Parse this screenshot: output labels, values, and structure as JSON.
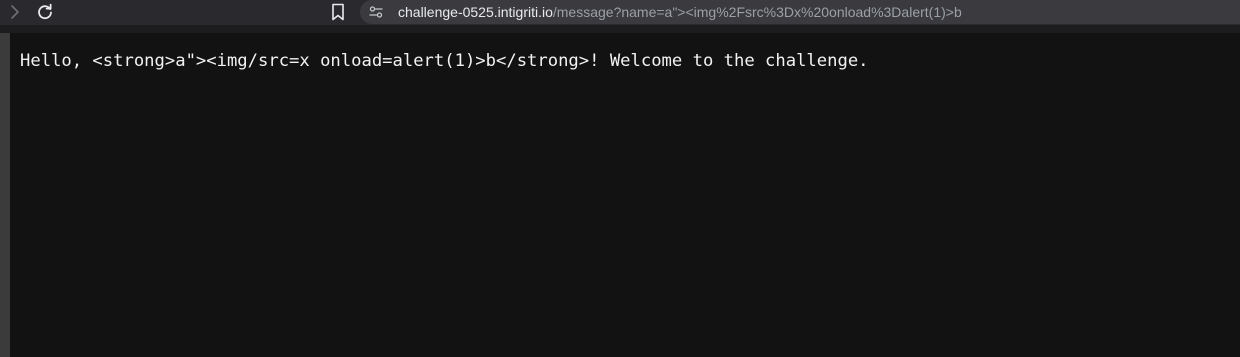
{
  "browser": {
    "url": {
      "host": "challenge-0525.intigriti.io",
      "path": "/message?name=a\"><img%2Fsrc%3Dx%20onload%3Dalert(1)>b"
    },
    "icons": {
      "forward": "forward-arrow-icon",
      "reload": "reload-icon",
      "bookmark": "bookmark-icon",
      "site_info": "site-settings-icon"
    },
    "colors": {
      "toolbar": "#2a2a2e",
      "urlbar": "#3a3a3f",
      "page_background": "#121212",
      "text": "#f2f2f2"
    }
  },
  "page": {
    "message": "Hello, <strong>a\"><img/src=x onload=alert(1)>b</strong>! Welcome to the challenge."
  }
}
